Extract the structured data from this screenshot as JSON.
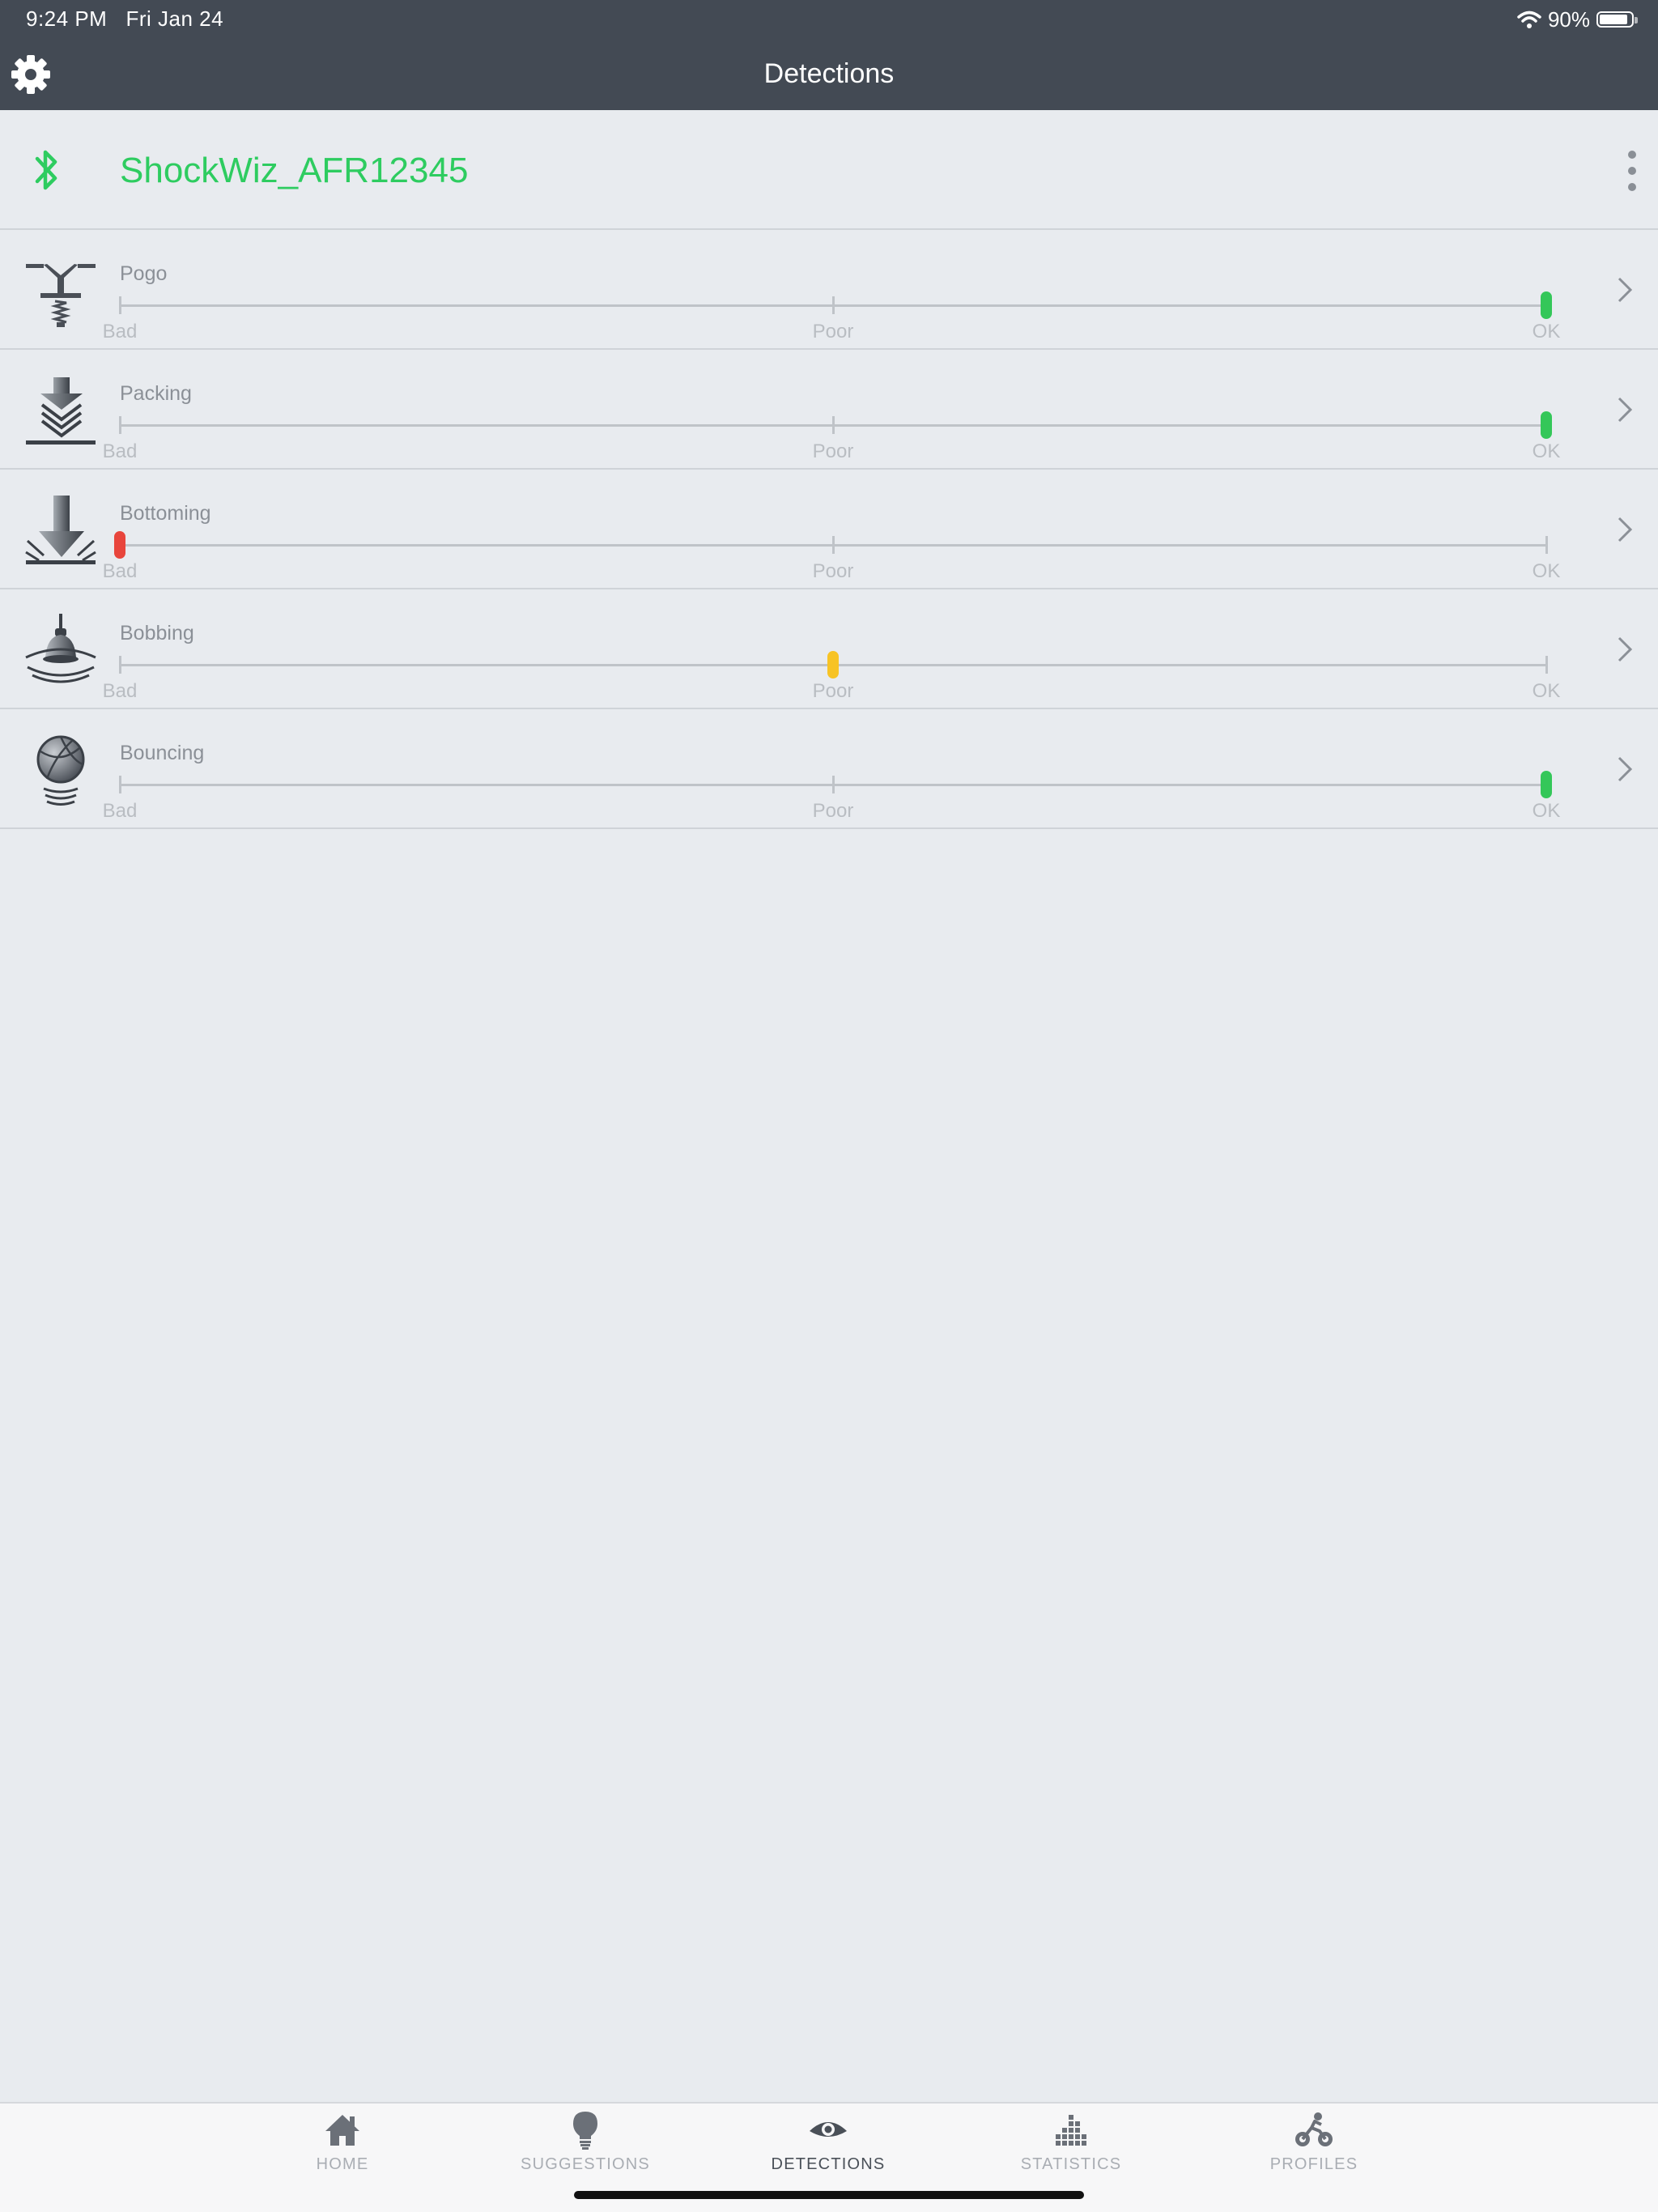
{
  "status_bar": {
    "time": "9:24 PM",
    "date": "Fri Jan 24",
    "battery": "90%",
    "battery_fraction": 0.9
  },
  "header": {
    "title": "Detections",
    "settings_icon": "gear-icon"
  },
  "device": {
    "name": "ShockWiz_AFR12345",
    "icon": "bluetooth-icon",
    "menu_icon": "more-vertical-icon",
    "name_color": "#2ecc60"
  },
  "scale": {
    "bad": "Bad",
    "poor": "Poor",
    "ok": "OK"
  },
  "colors": {
    "ok": "#34c759",
    "poor": "#f7c325",
    "bad": "#e8453c",
    "header_bg": "#434a54"
  },
  "detections": [
    {
      "label": "Pogo",
      "icon": "pogo-stick-icon",
      "level": 1.0,
      "status": "ok"
    },
    {
      "label": "Packing",
      "icon": "packing-arrow-icon",
      "level": 1.0,
      "status": "ok"
    },
    {
      "label": "Bottoming",
      "icon": "bottoming-arrow-icon",
      "level": 0.0,
      "status": "bad"
    },
    {
      "label": "Bobbing",
      "icon": "bobbing-icon",
      "level": 0.5,
      "status": "poor"
    },
    {
      "label": "Bouncing",
      "icon": "bouncing-ball-icon",
      "level": 1.0,
      "status": "ok"
    }
  ],
  "tabs": [
    {
      "label": "HOME",
      "icon": "home-icon",
      "active": false
    },
    {
      "label": "SUGGESTIONS",
      "icon": "lightbulb-icon",
      "active": false
    },
    {
      "label": "DETECTIONS",
      "icon": "eye-icon",
      "active": true
    },
    {
      "label": "STATISTICS",
      "icon": "bar-chart-icon",
      "active": false
    },
    {
      "label": "PROFILES",
      "icon": "bicycle-icon",
      "active": false
    }
  ]
}
